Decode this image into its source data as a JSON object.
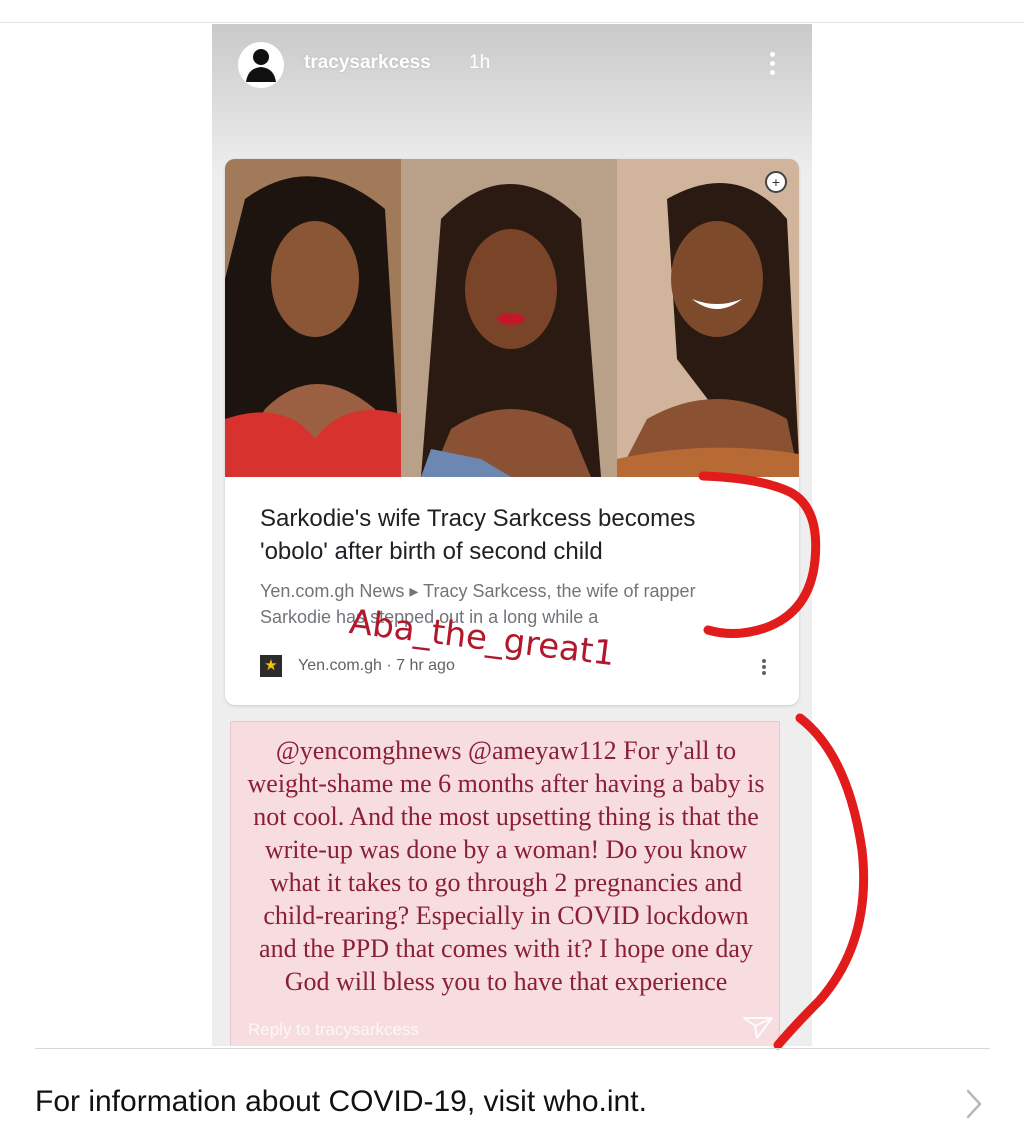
{
  "story": {
    "username": "tracysarkcess",
    "time": "1h",
    "reply_placeholder": "Reply to tracysarkcess"
  },
  "article": {
    "title": "Sarkodie's wife Tracy Sarkcess becomes 'obolo' after birth of second child",
    "snippet": "Yen.com.gh News ▸ Tracy Sarkcess, the wife of rapper Sarkodie has stepped out in a long while a",
    "source": "Yen.com.gh · 7 hr ago"
  },
  "watermark": "Aba_the_great1",
  "quote": {
    "text": "@yencomghnews @ameyaw112 For y'all to weight-shame me 6 months after having a baby is not cool. And the most upsetting thing is that the write-up was done by a woman! Do you know what it takes to go through 2 pregnancies and child-rearing? Especially in COVID lockdown and the PPD that comes with it? I hope one day God will bless you to have that experience"
  },
  "info_banner": {
    "text": "For information about COVID-19, visit who.int."
  },
  "colors": {
    "annotation_red": "#e21b1b",
    "quote_text": "#8a1f35",
    "quote_bg": "#f7dde0"
  },
  "icons": [
    "avatar-icon",
    "more-vert-icon",
    "add-icon",
    "yen-logo-icon",
    "send-icon",
    "chevron-right-icon"
  ]
}
